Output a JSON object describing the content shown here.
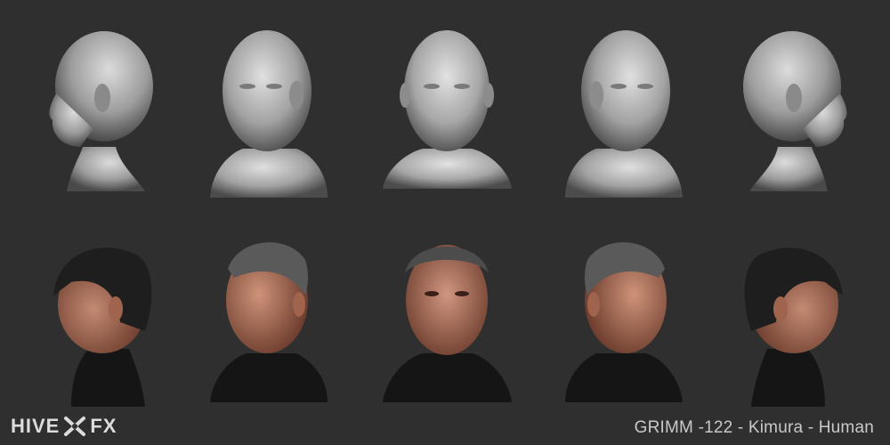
{
  "caption": "GRIMM -122 - Kimura - Human",
  "logo": {
    "left": "HIVE",
    "right": "FX"
  },
  "colors": {
    "background": "#2f2f2f",
    "sculpt_light": "#d6d6d6",
    "sculpt_mid": "#9a9a9a",
    "sculpt_dark": "#4a4a4a",
    "skin_light": "#c48a72",
    "skin_dark": "#6b3b2c",
    "hair": "#1e1e1e",
    "hair_gray": "#6a6a6a",
    "collar": "#151515"
  },
  "rows": [
    {
      "name": "sculpt",
      "views": [
        "left-profile",
        "left-three-quarter",
        "front",
        "right-three-quarter",
        "right-profile"
      ]
    },
    {
      "name": "textured",
      "views": [
        "left-profile",
        "left-three-quarter",
        "front",
        "right-three-quarter",
        "right-profile"
      ]
    }
  ]
}
